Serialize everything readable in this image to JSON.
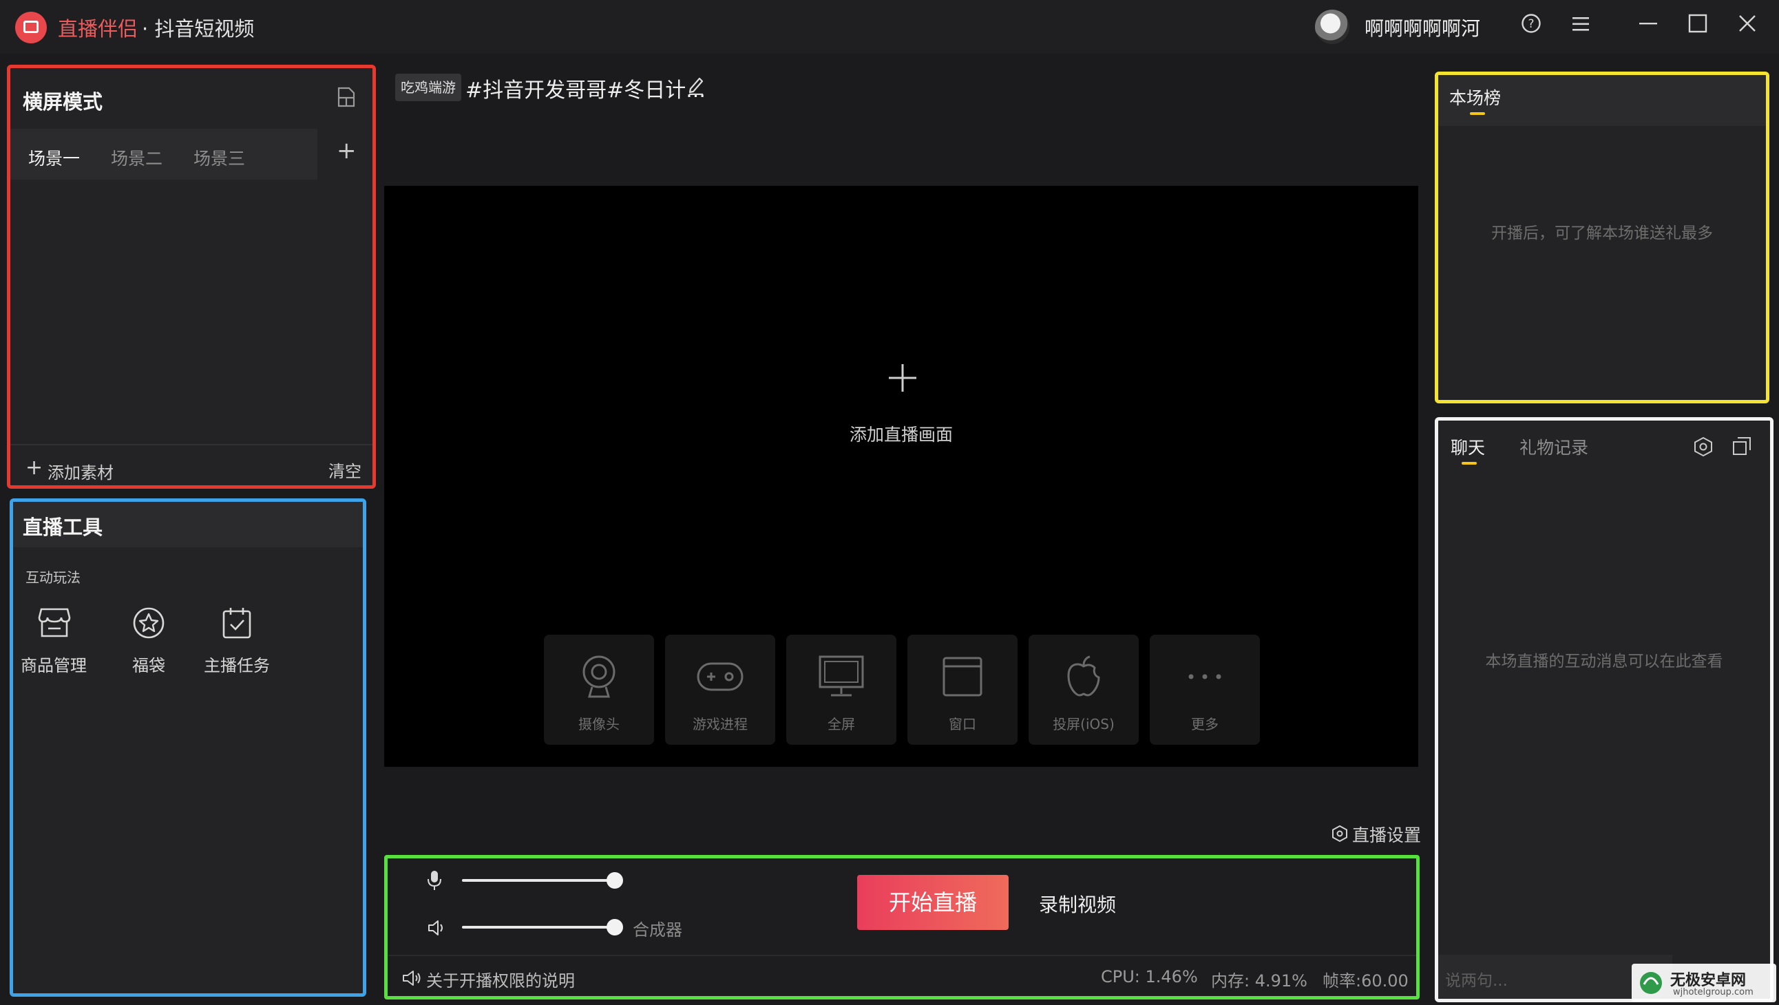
{
  "titlebar": {
    "app_name": "直播伴侣",
    "app_subtitle": "· 抖音短视频",
    "user_name": "啊啊啊啊啊河",
    "help_icon": "?",
    "menu_icon": "≡",
    "minimize_icon": "—",
    "maximize_icon": "☐",
    "close_icon": "✕"
  },
  "scene_panel": {
    "title": "横屏模式",
    "tabs": [
      "场景一",
      "场景二",
      "场景三"
    ],
    "add_tab": "+",
    "add_material": "添加素材",
    "clear": "清空"
  },
  "tools_panel": {
    "title": "直播工具",
    "section": "互动玩法",
    "tools": [
      "商品管理",
      "福袋",
      "主播任务"
    ]
  },
  "center": {
    "category_tag": "吃鸡端游",
    "stream_title": "#抖音开发哥哥#冬日计...",
    "add_scene_label": "添加直播画面",
    "sources": [
      "摄像头",
      "游戏进程",
      "全屏",
      "窗口",
      "投屏(iOS)",
      "更多"
    ],
    "live_settings": "直播设置",
    "mixer_label": "合成器",
    "start_live": "开始直播",
    "record_video": "录制视频",
    "permission_note": "关于开播权限的说明",
    "stats": {
      "cpu": "CPU: 1.46%",
      "memory": "内存: 4.91%",
      "fps": "帧率:60.00"
    },
    "mic_volume": 1.0,
    "speaker_volume": 1.0
  },
  "rank_panel": {
    "title": "本场榜",
    "empty_text": "开播后，可了解本场谁送礼最多"
  },
  "chat_panel": {
    "tabs": [
      "聊天",
      "礼物记录"
    ],
    "empty_text": "本场直播的互动消息可以在此查看",
    "input_placeholder": "说两句..."
  },
  "watermark": {
    "name": "无极安卓网",
    "url": "wjhotelgroup.com"
  },
  "colors": {
    "brand_red": "#ee5b5d",
    "start_button": "#e9405a",
    "tab_underline": "#f5c518"
  }
}
